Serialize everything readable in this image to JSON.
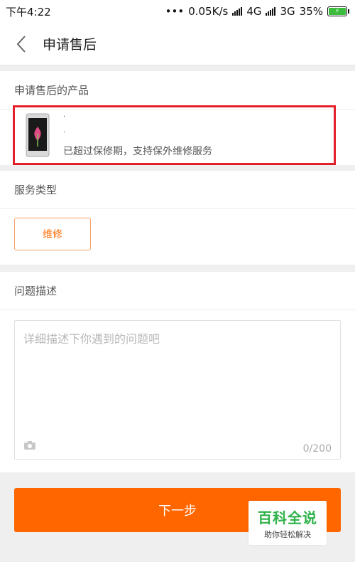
{
  "status": {
    "time": "下午4:22",
    "dots": "•••",
    "speed": "0.05K/s",
    "net1": "4G",
    "net2": "3G",
    "battery_pct": "35%"
  },
  "nav": {
    "title": "申请售后"
  },
  "product_section": {
    "header": "申请售后的产品",
    "line1": "·",
    "line2": "·",
    "warranty_note": "已超过保修期，支持保外维修服务"
  },
  "service_section": {
    "header": "服务类型",
    "option_label": "维修"
  },
  "problem_section": {
    "header": "问题描述",
    "placeholder": "详细描述下你遇到的问题吧",
    "counter": "0/200"
  },
  "actions": {
    "next_label": "下一步"
  },
  "watermark": {
    "title": "百科全说",
    "subtitle": "助你轻松解决"
  },
  "colors": {
    "accent": "#ff6600",
    "highlight_border": "#e3202a",
    "brand_green": "#2fb24a"
  }
}
